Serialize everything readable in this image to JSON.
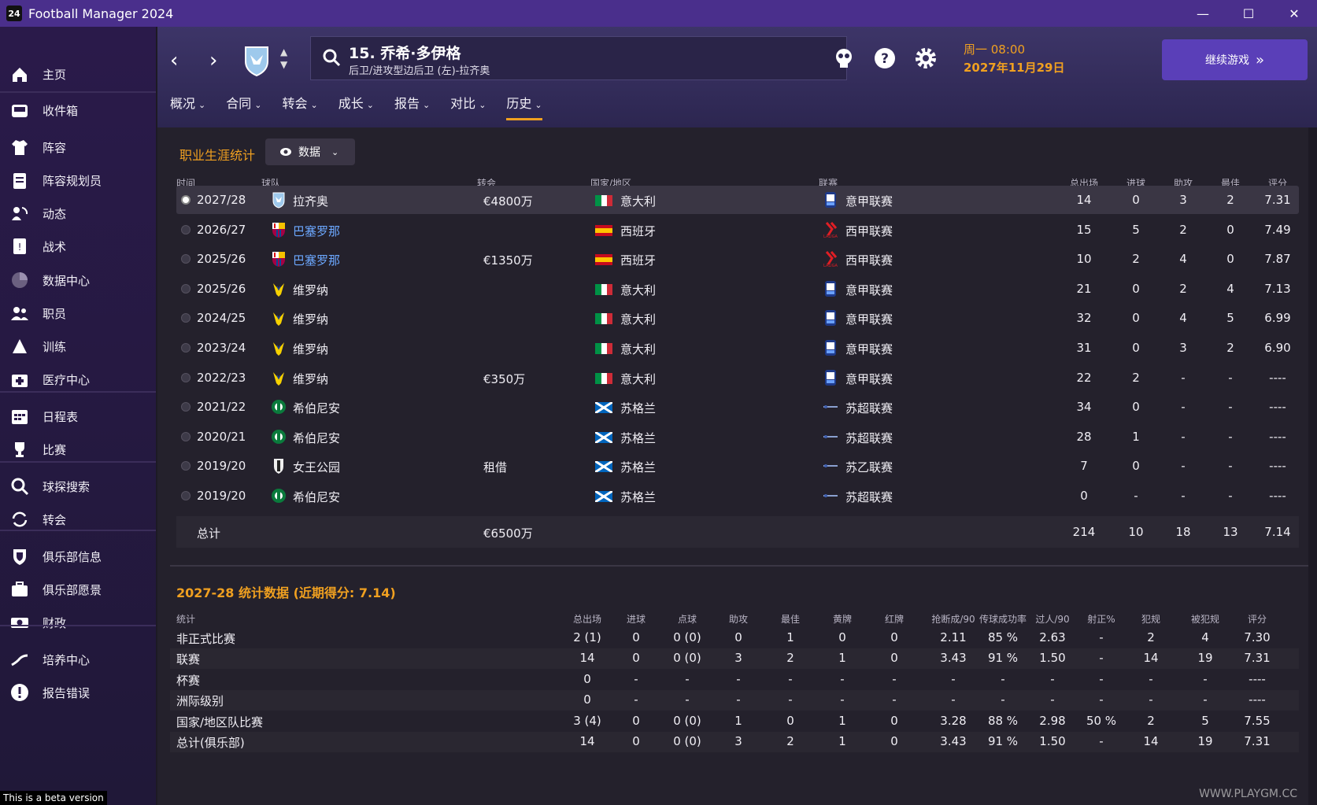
{
  "window": {
    "title": "Football Manager 2024",
    "logo": "24",
    "minimize": "—",
    "maximize": "☐",
    "close": "✕"
  },
  "sidebar": {
    "items": [
      {
        "label": "主页",
        "icon": "home-icon"
      },
      {
        "label": "收件箱",
        "icon": "inbox-icon"
      },
      {
        "label": "阵容",
        "icon": "shirt-icon"
      },
      {
        "label": "阵容规划员",
        "icon": "clipboard-icon"
      },
      {
        "label": "动态",
        "icon": "dynamics-icon"
      },
      {
        "label": "战术",
        "icon": "tactics-icon"
      },
      {
        "label": "数据中心",
        "icon": "data-hub-icon"
      },
      {
        "label": "职员",
        "icon": "staff-icon"
      },
      {
        "label": "训练",
        "icon": "training-icon"
      },
      {
        "label": "医疗中心",
        "icon": "medical-icon"
      },
      {
        "label": "日程表",
        "icon": "calendar-icon"
      },
      {
        "label": "比赛",
        "icon": "trophy-icon"
      },
      {
        "label": "球探搜索",
        "icon": "scouting-icon"
      },
      {
        "label": "转会",
        "icon": "transfer-icon"
      },
      {
        "label": "俱乐部信息",
        "icon": "shield-icon"
      },
      {
        "label": "俱乐部愿景",
        "icon": "briefcase-icon"
      },
      {
        "label": "财政",
        "icon": "finance-icon"
      },
      {
        "label": "培养中心",
        "icon": "development-icon"
      },
      {
        "label": "报告错误",
        "icon": "alert-icon"
      }
    ],
    "beta": "This is a beta version"
  },
  "header": {
    "player_name": "15. 乔希·多伊格",
    "player_position": "后卫/进攻型边后卫 (左)-拉齐奥",
    "date_day": "周一 08:00",
    "date_date": "2027年11月29日",
    "continue_label": "继续游戏",
    "continue_icon": "»",
    "tabs": [
      {
        "label": "概况"
      },
      {
        "label": "合同"
      },
      {
        "label": "转会"
      },
      {
        "label": "成长"
      },
      {
        "label": "报告"
      },
      {
        "label": "对比"
      },
      {
        "label": "历史"
      }
    ],
    "active_tab": "历史"
  },
  "career": {
    "title": "职业生涯统计",
    "view_label": "数据",
    "columns": {
      "season": "时间",
      "team": "球队",
      "transfer": "转会",
      "nation": "国家/地区",
      "league": "联赛",
      "apps": "总出场",
      "goals": "进球",
      "assists": "助攻",
      "pom": "最佳",
      "rating": "评分"
    },
    "rows": [
      {
        "season": "2027/28",
        "team": "拉齐奥",
        "transfer": "€4800万",
        "nation": "意大利",
        "league": "意甲联赛",
        "apps": "14",
        "goals": "0",
        "assists": "3",
        "pom": "2",
        "rating": "7.31",
        "crest": "lazio",
        "flag": "italy",
        "link": false
      },
      {
        "season": "2026/27",
        "team": "巴塞罗那",
        "transfer": "",
        "nation": "西班牙",
        "league": "西甲联赛",
        "apps": "15",
        "goals": "5",
        "assists": "2",
        "pom": "0",
        "rating": "7.49",
        "crest": "barcelona",
        "flag": "spain",
        "link": true
      },
      {
        "season": "2025/26",
        "team": "巴塞罗那",
        "transfer": "€1350万",
        "nation": "西班牙",
        "league": "西甲联赛",
        "apps": "10",
        "goals": "2",
        "assists": "4",
        "pom": "0",
        "rating": "7.87",
        "crest": "barcelona",
        "flag": "spain",
        "link": true
      },
      {
        "season": "2025/26",
        "team": "维罗纳",
        "transfer": "",
        "nation": "意大利",
        "league": "意甲联赛",
        "apps": "21",
        "goals": "0",
        "assists": "2",
        "pom": "4",
        "rating": "7.13",
        "crest": "verona",
        "flag": "italy",
        "link": false
      },
      {
        "season": "2024/25",
        "team": "维罗纳",
        "transfer": "",
        "nation": "意大利",
        "league": "意甲联赛",
        "apps": "32",
        "goals": "0",
        "assists": "4",
        "pom": "5",
        "rating": "6.99",
        "crest": "verona",
        "flag": "italy",
        "link": false
      },
      {
        "season": "2023/24",
        "team": "维罗纳",
        "transfer": "",
        "nation": "意大利",
        "league": "意甲联赛",
        "apps": "31",
        "goals": "0",
        "assists": "3",
        "pom": "2",
        "rating": "6.90",
        "crest": "verona",
        "flag": "italy",
        "link": false
      },
      {
        "season": "2022/23",
        "team": "维罗纳",
        "transfer": "€350万",
        "nation": "意大利",
        "league": "意甲联赛",
        "apps": "22",
        "goals": "2",
        "assists": "-",
        "pom": "-",
        "rating": "----",
        "crest": "verona",
        "flag": "italy",
        "link": false
      },
      {
        "season": "2021/22",
        "team": "希伯尼安",
        "transfer": "",
        "nation": "苏格兰",
        "league": "苏超联赛",
        "apps": "34",
        "goals": "0",
        "assists": "-",
        "pom": "-",
        "rating": "----",
        "crest": "hibernian",
        "flag": "scotland",
        "link": false
      },
      {
        "season": "2020/21",
        "team": "希伯尼安",
        "transfer": "",
        "nation": "苏格兰",
        "league": "苏超联赛",
        "apps": "28",
        "goals": "1",
        "assists": "-",
        "pom": "-",
        "rating": "----",
        "crest": "hibernian",
        "flag": "scotland",
        "link": false
      },
      {
        "season": "2019/20",
        "team": "女王公园",
        "transfer": "租借",
        "nation": "苏格兰",
        "league": "苏乙联赛",
        "apps": "7",
        "goals": "0",
        "assists": "-",
        "pom": "-",
        "rating": "----",
        "crest": "queens-park",
        "flag": "scotland",
        "link": false
      },
      {
        "season": "2019/20",
        "team": "希伯尼安",
        "transfer": "",
        "nation": "苏格兰",
        "league": "苏超联赛",
        "apps": "0",
        "goals": "-",
        "assists": "-",
        "pom": "-",
        "rating": "----",
        "crest": "hibernian",
        "flag": "scotland",
        "link": false
      }
    ],
    "total": {
      "label": "总计",
      "transfer": "€6500万",
      "apps": "214",
      "goals": "10",
      "assists": "18",
      "pom": "13",
      "rating": "7.14"
    }
  },
  "season_stats": {
    "title": "2027-28 统计数据 (近期得分: 7.14)",
    "columns": [
      "统计",
      "总出场",
      "进球",
      "点球",
      "助攻",
      "最佳",
      "黄牌",
      "红牌",
      "抢断成/90",
      "传球成功率",
      "过人/90",
      "射正%",
      "犯规",
      "被犯规",
      "评分"
    ],
    "rows": [
      [
        "非正式比赛",
        "2 (1)",
        "0",
        "0 (0)",
        "0",
        "1",
        "0",
        "0",
        "2.11",
        "85 %",
        "2.63",
        "-",
        "2",
        "4",
        "7.30"
      ],
      [
        "联赛",
        "14",
        "0",
        "0 (0)",
        "3",
        "2",
        "1",
        "0",
        "3.43",
        "91 %",
        "1.50",
        "-",
        "14",
        "19",
        "7.31"
      ],
      [
        "杯赛",
        "0",
        "-",
        "-",
        "-",
        "-",
        "-",
        "-",
        "-",
        "-",
        "-",
        "-",
        "-",
        "-",
        "----"
      ],
      [
        "洲际级别",
        "0",
        "-",
        "-",
        "-",
        "-",
        "-",
        "-",
        "-",
        "-",
        "-",
        "-",
        "-",
        "-",
        "----"
      ],
      [
        "国家/地区队比赛",
        "3 (4)",
        "0",
        "0 (0)",
        "1",
        "0",
        "1",
        "0",
        "3.28",
        "88 %",
        "2.98",
        "50 %",
        "2",
        "5",
        "7.55"
      ],
      [
        "总计(俱乐部)",
        "14",
        "0",
        "0 (0)",
        "3",
        "2",
        "1",
        "0",
        "3.43",
        "91 %",
        "1.50",
        "-",
        "14",
        "19",
        "7.31"
      ]
    ]
  },
  "watermark": "WWW.PLAYGM.CC"
}
